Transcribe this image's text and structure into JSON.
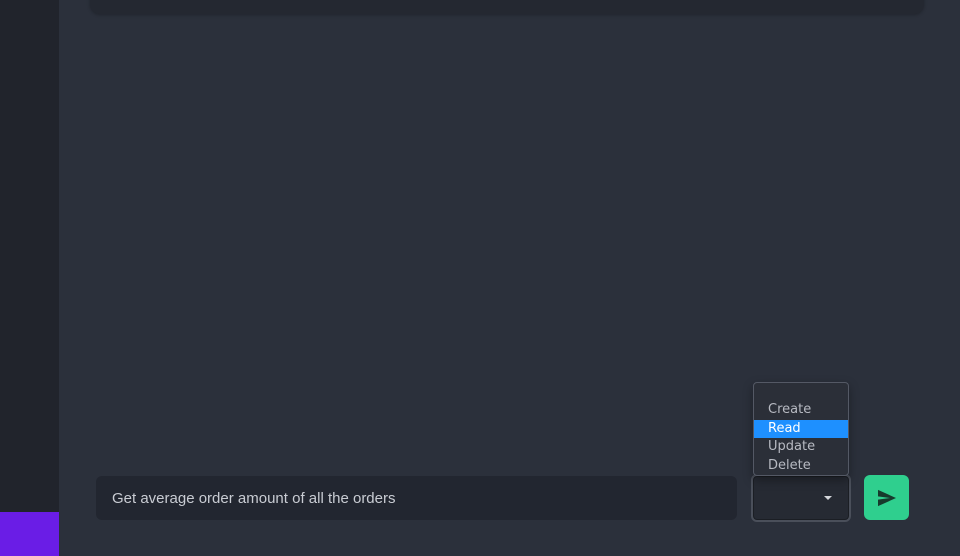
{
  "chat": {
    "input_value": "Get average order amount of all the orders",
    "input_placeholder": ""
  },
  "operation_select": {
    "selected": "Read",
    "options": [
      "Create",
      "Read",
      "Update",
      "Delete"
    ]
  },
  "send_button": {
    "icon": "send-icon"
  },
  "colors": {
    "sidebar": "#21242c",
    "sidebar_accent": "#6a1de6",
    "main_background": "#2b303b",
    "selected_option": "#1e90ff",
    "send_button": "#2fcf8e"
  }
}
